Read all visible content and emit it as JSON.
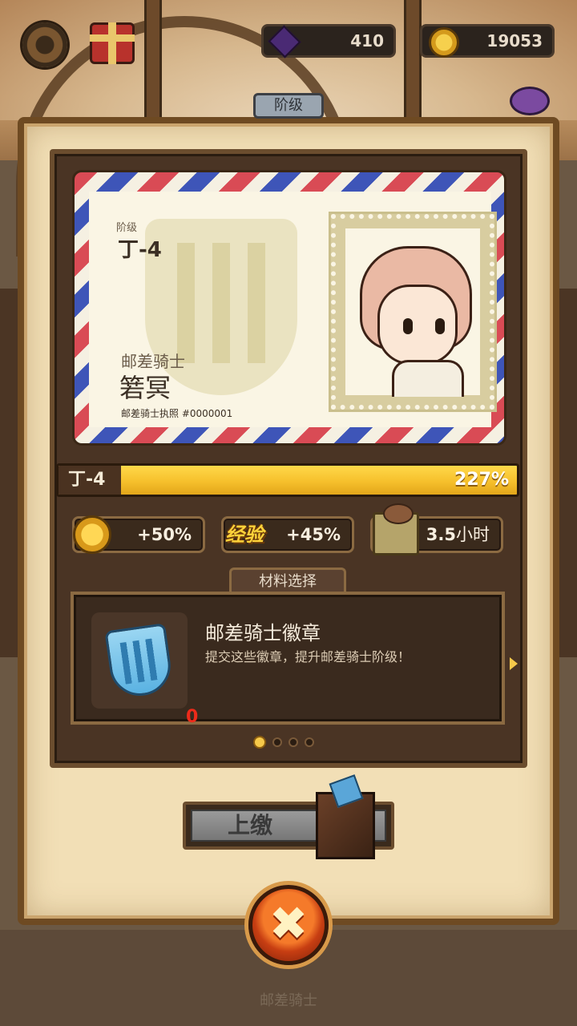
{
  "hud": {
    "gems": "410",
    "gold": "19053"
  },
  "panel": {
    "tag": "阶级"
  },
  "card": {
    "rank_label": "阶级",
    "rank": "丁-4",
    "title": "邮差骑士",
    "name": "箬冥",
    "license": "邮差骑士执照 #0000001"
  },
  "progress": {
    "rank": "丁-4",
    "percent_text": "227%",
    "fill_fraction": 1.0
  },
  "bonuses": {
    "gold": "+50%",
    "exp_label": "经验",
    "exp": "+45%",
    "time_value": "3.5",
    "time_unit": "小时"
  },
  "material": {
    "section_label": "材料选择",
    "title": "邮差骑士徽章",
    "description": "提交这些徽章，提升邮差骑士阶级！",
    "count": "0",
    "page_total": 4,
    "page_current": 1
  },
  "actions": {
    "submit_label": "上缴",
    "close_symbol": "✖"
  },
  "footer": {
    "label": "邮差骑士"
  },
  "icons": [
    "gear-icon",
    "gift-icon",
    "gem-icon",
    "coin-icon",
    "purple-pot-icon",
    "coin-icon",
    "crate-icon",
    "badge-icon",
    "box-icon",
    "close-icon"
  ]
}
